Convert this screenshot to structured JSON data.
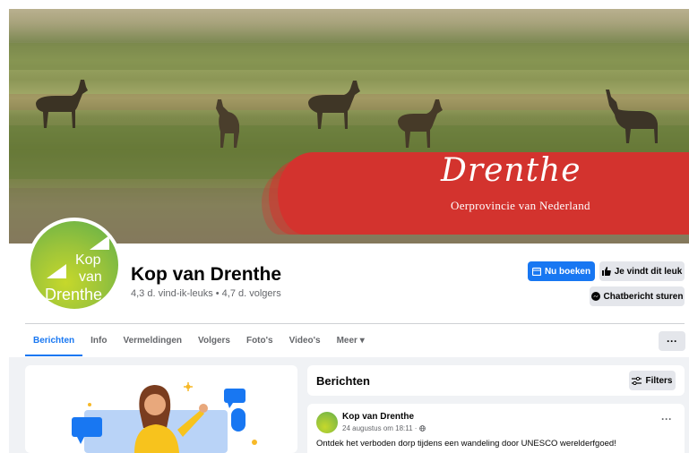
{
  "cover": {
    "banner_script": "Drenthe",
    "banner_subtitle": "Oerprovincie van Nederland"
  },
  "profile": {
    "avatar_lines": [
      "Kop",
      "van",
      "Drenthe"
    ],
    "name": "Kop van Drenthe",
    "stats": "4,3 d. vind-ik-leuks • 4,7 d. volgers"
  },
  "actions": {
    "book_label": "Nu boeken",
    "like_label": "Je vindt dit leuk",
    "chat_label": "Chatbericht sturen",
    "book_icon": "calendar-icon",
    "like_icon": "thumbs-up-icon",
    "chat_icon": "messenger-icon"
  },
  "tabs": [
    {
      "label": "Berichten",
      "active": true
    },
    {
      "label": "Info"
    },
    {
      "label": "Vermeldingen"
    },
    {
      "label": "Volgers"
    },
    {
      "label": "Foto's"
    },
    {
      "label": "Video's"
    },
    {
      "label": "Meer ▾"
    }
  ],
  "more_button": "···",
  "feed": {
    "section_title": "Berichten",
    "filters_label": "Filters",
    "post": {
      "author": "Kop van Drenthe",
      "date": "24 augustus om 18:11 · ",
      "text": "Ontdek het verboden dorp tijdens een wandeling door UNESCO werelderfgoed!",
      "menu": "···"
    }
  },
  "colors": {
    "accent": "#1877f2",
    "banner_red": "#d3332e",
    "brand_green": "#8ec03f"
  }
}
